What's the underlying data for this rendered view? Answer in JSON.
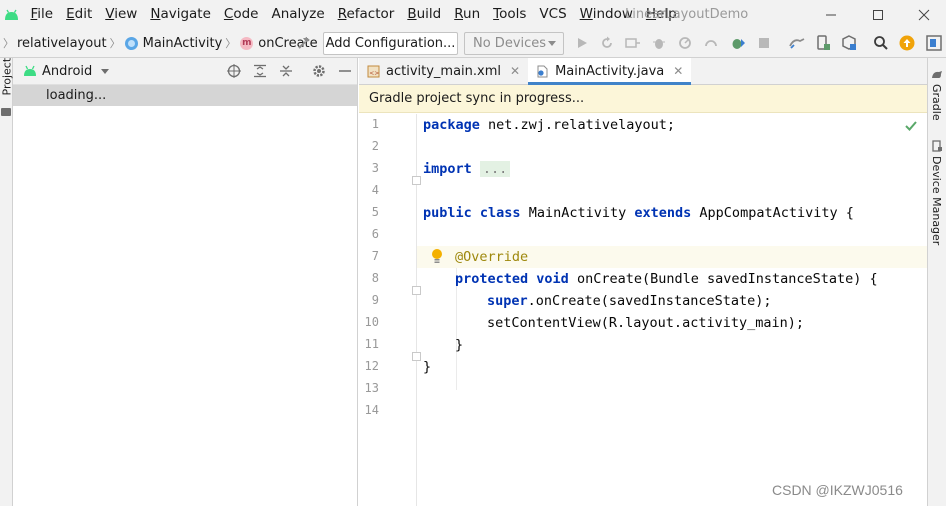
{
  "app": {
    "project_title": "LinearLayoutDemo"
  },
  "menu": {
    "items": [
      {
        "mnemonic": "F",
        "rest": "ile"
      },
      {
        "mnemonic": "E",
        "rest": "dit"
      },
      {
        "mnemonic": "V",
        "rest": "iew"
      },
      {
        "mnemonic": "N",
        "rest": "avigate"
      },
      {
        "mnemonic": "C",
        "rest": "ode"
      },
      {
        "mnemonic": "",
        "rest": "Analyze"
      },
      {
        "mnemonic": "R",
        "rest": "efactor"
      },
      {
        "mnemonic": "B",
        "rest": "uild"
      },
      {
        "mnemonic": "R",
        "rest": "un"
      },
      {
        "mnemonic": "T",
        "rest": "ools"
      },
      {
        "mnemonic": "",
        "rest": "VCS"
      },
      {
        "mnemonic": "W",
        "rest": "indow"
      },
      {
        "mnemonic": "H",
        "rest": "elp"
      }
    ]
  },
  "breadcrumb": {
    "module": "relativelayout",
    "class": "MainActivity",
    "method": "onCreate"
  },
  "toolbar": {
    "add_config_label": "Add Configuration...",
    "device_selected": "No Devices"
  },
  "project_panel": {
    "strip_label": "Project",
    "view_mode": "Android",
    "loading_text": "loading..."
  },
  "editor": {
    "tabs": [
      {
        "label": "activity_main.xml",
        "active": false
      },
      {
        "label": "MainActivity.java",
        "active": true
      }
    ],
    "banner": "Gradle project sync in progress...",
    "line_numbers": [
      "1",
      "2",
      "3",
      "4",
      "5",
      "6",
      "7",
      "8",
      "9",
      "10",
      "11",
      "12",
      "13",
      "14"
    ],
    "code": {
      "l1_kw": "package",
      "l1_rest": " net.zwj.relativelayout;",
      "l3_kw": "import",
      "l3_fold": "...",
      "l5_kw1": "public",
      "l5_kw2": "class",
      "l5_name": "MainActivity",
      "l5_kw3": "extends",
      "l5_rest": " AppCompatActivity {",
      "l7_ann": "@Override",
      "l8_kw1": "protected",
      "l8_kw2": "void",
      "l8_rest": " onCreate(Bundle savedInstanceState) {",
      "l9_kw": "super",
      "l9_rest": ".onCreate(savedInstanceState);",
      "l10": "setContentView(R.layout.activity_main);",
      "l11": "}",
      "l12": "}"
    }
  },
  "right_strip": {
    "gradle_label": "Gradle",
    "device_manager_label": "Device Manager"
  },
  "watermark": "CSDN @IKZWJ0516",
  "colors": {
    "keyword": "#0033b3",
    "annotation": "#9e880d",
    "banner_bg": "#fcf6d9",
    "tab_underline": "#4083c9",
    "check_green": "#59a869"
  }
}
